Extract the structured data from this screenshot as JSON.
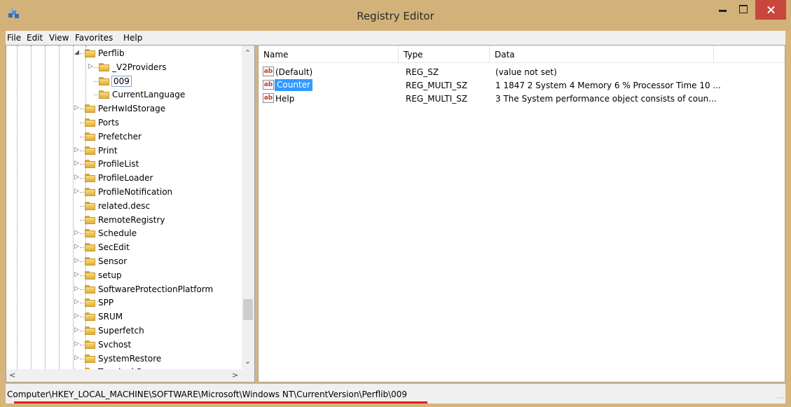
{
  "window": {
    "title": "Registry Editor"
  },
  "menu": [
    "File",
    "Edit",
    "View",
    "Favorites",
    "Help"
  ],
  "tree": {
    "items": [
      {
        "label": "Perflib",
        "expander": "expanded"
      },
      {
        "label": "_V2Providers",
        "expander": "collapsed"
      },
      {
        "label": "009",
        "expander": "none",
        "selected": true
      },
      {
        "label": "CurrentLanguage",
        "expander": "none"
      },
      {
        "label": "PerHwIdStorage",
        "expander": "collapsed"
      },
      {
        "label": "Ports",
        "expander": "none"
      },
      {
        "label": "Prefetcher",
        "expander": "none"
      },
      {
        "label": "Print",
        "expander": "collapsed"
      },
      {
        "label": "ProfileList",
        "expander": "collapsed"
      },
      {
        "label": "ProfileLoader",
        "expander": "collapsed"
      },
      {
        "label": "ProfileNotification",
        "expander": "collapsed"
      },
      {
        "label": "related.desc",
        "expander": "none"
      },
      {
        "label": "RemoteRegistry",
        "expander": "none"
      },
      {
        "label": "Schedule",
        "expander": "collapsed"
      },
      {
        "label": "SecEdit",
        "expander": "collapsed"
      },
      {
        "label": "Sensor",
        "expander": "collapsed"
      },
      {
        "label": "setup",
        "expander": "collapsed"
      },
      {
        "label": "SoftwareProtectionPlatform",
        "expander": "collapsed"
      },
      {
        "label": "SPP",
        "expander": "collapsed"
      },
      {
        "label": "SRUM",
        "expander": "collapsed"
      },
      {
        "label": "Superfetch",
        "expander": "collapsed"
      },
      {
        "label": "Svchost",
        "expander": "collapsed"
      },
      {
        "label": "SystemRestore",
        "expander": "collapsed"
      },
      {
        "label": "Terminal Server",
        "expander": "collapsed"
      }
    ]
  },
  "values": {
    "columns": [
      "Name",
      "Type",
      "Data"
    ],
    "rows": [
      {
        "name": "(Default)",
        "type": "REG_SZ",
        "data": "(value not set)",
        "selected": false
      },
      {
        "name": "Counter",
        "type": "REG_MULTI_SZ",
        "data": "1 1847 2 System 4 Memory 6 % Processor Time 10 ...",
        "selected": true
      },
      {
        "name": "Help",
        "type": "REG_MULTI_SZ",
        "data": "3 The System performance object consists of coun...",
        "selected": false
      }
    ]
  },
  "status": {
    "path": "Computer\\HKEY_LOCAL_MACHINE\\SOFTWARE\\Microsoft\\Windows NT\\CurrentVersion\\Perflib\\009"
  },
  "icons": {
    "app": "registry-editor-icon",
    "folder": "folder-icon",
    "value": "string-value-icon",
    "minimize": "minimize-icon",
    "maximize": "maximize-icon",
    "close": "close-icon"
  },
  "colors": {
    "titlebar": "#d3b27a",
    "selection": "#3399ff",
    "close": "#c9463d",
    "annotation_underline": "#e0201a"
  }
}
